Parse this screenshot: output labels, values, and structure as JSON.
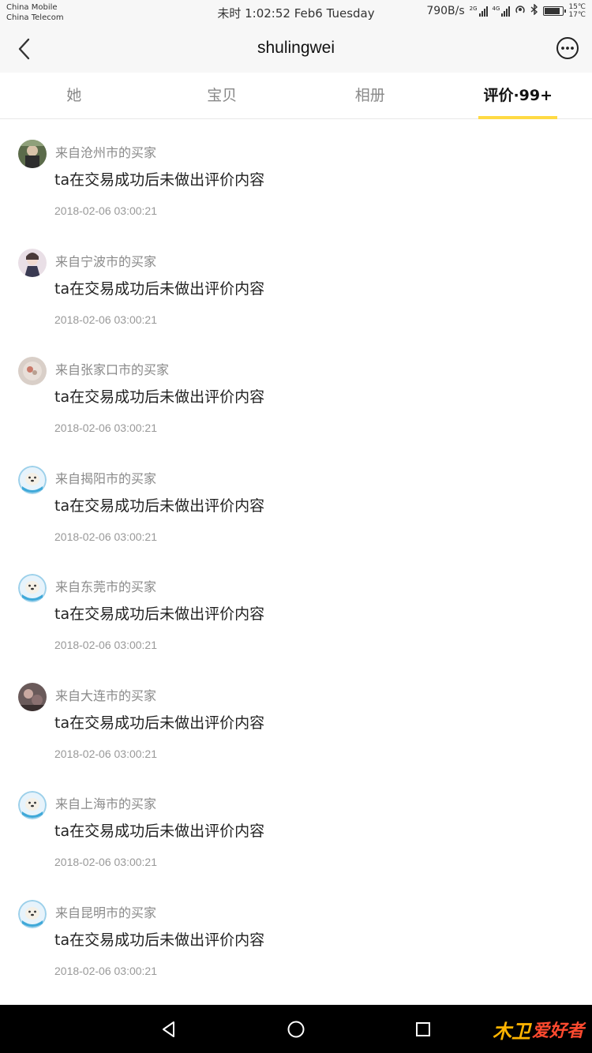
{
  "status_bar": {
    "carrier_1": "China Mobile",
    "carrier_2": "China Telecom",
    "time_date": "未时 1:02:52 Feb6 Tuesday",
    "net_speed": "790B/s",
    "signal_1_label": "2G",
    "signal_2_label": "4G",
    "battery_level": 0.9,
    "temp_high": "15℃",
    "temp_low": "17℃"
  },
  "nav": {
    "title": "shulingwei",
    "back_icon": "chevron-left-icon",
    "more_icon": "more-horizontal-circle-icon"
  },
  "tabs": [
    {
      "label": "她",
      "active": false
    },
    {
      "label": "宝贝",
      "active": false
    },
    {
      "label": "相册",
      "active": false
    },
    {
      "label": "评价·99+",
      "active": true
    }
  ],
  "accent_color": "#ffda44",
  "reviews": [
    {
      "from": "来自沧州市的买家",
      "text": "ta在交易成功后未做出评价内容",
      "time": "2018-02-06 03:00:21",
      "avatar": "photo-avatar"
    },
    {
      "from": "来自宁波市的买家",
      "text": "ta在交易成功后未做出评价内容",
      "time": "2018-02-06 03:00:21",
      "avatar": "photo-avatar"
    },
    {
      "from": "来自张家口市的买家",
      "text": "ta在交易成功后未做出评价内容",
      "time": "2018-02-06 03:00:21",
      "avatar": "photo-avatar"
    },
    {
      "from": "来自揭阳市的买家",
      "text": "ta在交易成功后未做出评价内容",
      "time": "2018-02-06 03:00:21",
      "avatar": "default-seal-avatar"
    },
    {
      "from": "来自东莞市的买家",
      "text": "ta在交易成功后未做出评价内容",
      "time": "2018-02-06 03:00:21",
      "avatar": "default-seal-avatar"
    },
    {
      "from": "来自大连市的买家",
      "text": "ta在交易成功后未做出评价内容",
      "time": "2018-02-06 03:00:21",
      "avatar": "photo-avatar"
    },
    {
      "from": "来自上海市的买家",
      "text": "ta在交易成功后未做出评价内容",
      "time": "2018-02-06 03:00:21",
      "avatar": "default-seal-avatar"
    },
    {
      "from": "来自昆明市的买家",
      "text": "ta在交易成功后未做出评价内容",
      "time": "2018-02-06 03:00:21",
      "avatar": "default-seal-avatar"
    }
  ],
  "system_nav": {
    "back": "triangle-back-icon",
    "home": "circle-home-icon",
    "recent": "square-recent-icon"
  },
  "watermark": {
    "logo": "木卫",
    "text": "爱好者"
  }
}
